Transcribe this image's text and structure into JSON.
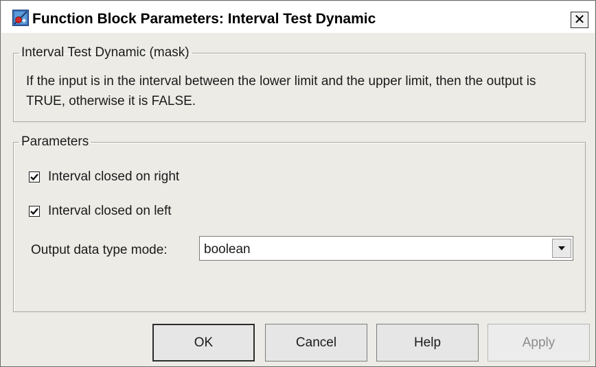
{
  "window": {
    "title": "Function Block Parameters: Interval Test Dynamic",
    "close_label": "✕"
  },
  "mask_group": {
    "legend": "Interval Test Dynamic (mask)",
    "description": "If the input is in the interval between the lower limit and the upper limit, then the output is TRUE, otherwise it is FALSE."
  },
  "parameters": {
    "legend": "Parameters",
    "checkboxes": [
      {
        "label": "Interval closed on right",
        "checked": true
      },
      {
        "label": "Interval closed on left",
        "checked": true
      }
    ],
    "output_mode": {
      "label": "Output data type mode:",
      "value": "boolean"
    }
  },
  "buttons": {
    "ok": "OK",
    "cancel": "Cancel",
    "help": "Help",
    "apply": "Apply"
  },
  "colors": {
    "window_bg": "#ecebe6",
    "title_bg": "#ffffff",
    "border": "#a8a69c",
    "disabled_text": "#8c8c8c"
  },
  "icons": {
    "title_icon": "simulink-block-icon",
    "dropdown_icon": "chevron-down-icon",
    "checkbox_icon": "checkmark-icon"
  }
}
